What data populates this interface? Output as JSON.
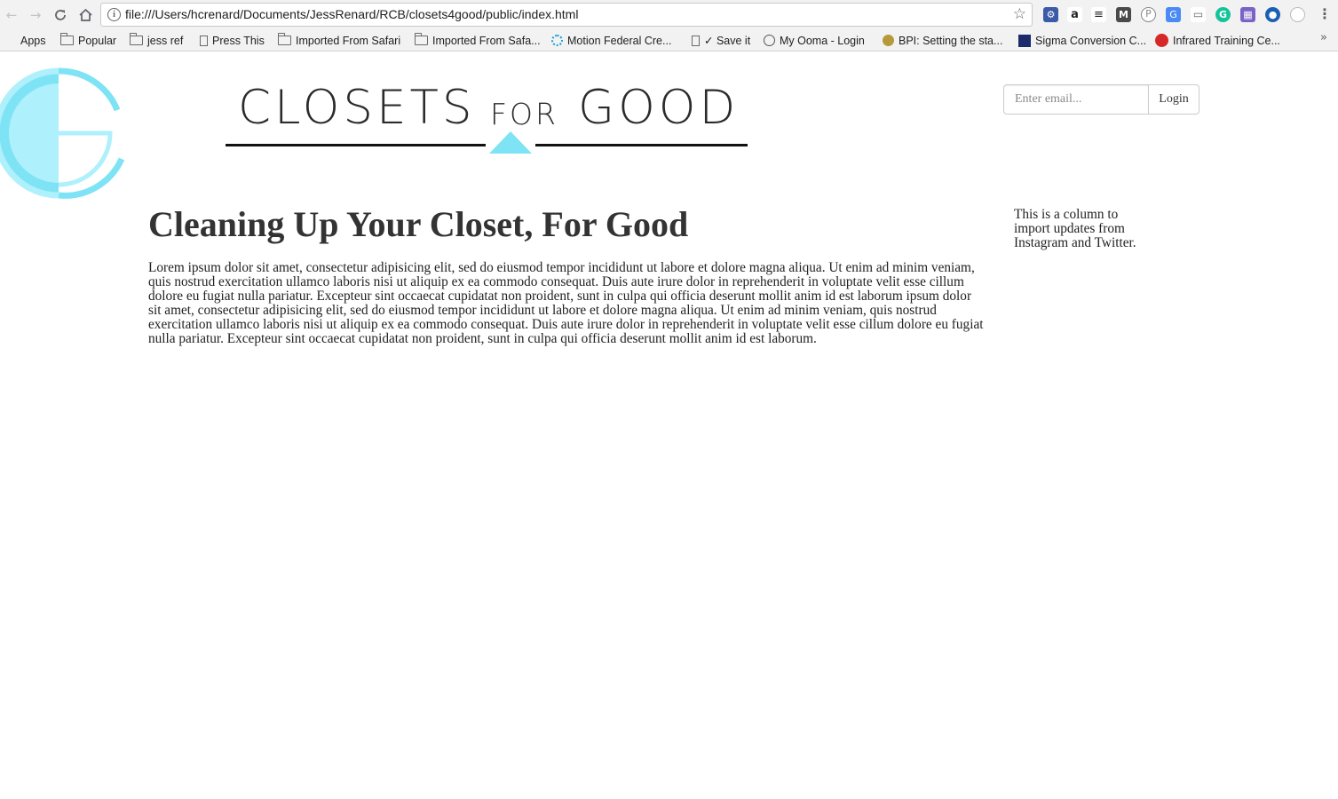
{
  "browser": {
    "url": "file:///Users/hcrenard/Documents/JessRenard/RCB/closets4good/public/index.html",
    "icons": {
      "back": "back-arrow-icon",
      "forward": "forward-arrow-icon",
      "reload": "reload-icon",
      "home": "home-icon",
      "info": "info-icon",
      "bookmark_star": "star-icon",
      "menu": "more-vert-icon",
      "overflow": "chevron-right-double-icon"
    },
    "bookmarks": [
      {
        "label": "Apps",
        "icon": "apps-grid-icon"
      },
      {
        "label": "Popular",
        "icon": "folder-icon"
      },
      {
        "label": "jess ref",
        "icon": "folder-icon"
      },
      {
        "label": "Press This",
        "icon": "page-icon"
      },
      {
        "label": "Imported From Safari",
        "icon": "folder-icon"
      },
      {
        "label": "Imported From Safa...",
        "icon": "folder-icon"
      },
      {
        "label": "Motion Federal Cre...",
        "icon": "motion-logo-icon"
      },
      {
        "label": "✓ Save it",
        "icon": "page-icon"
      },
      {
        "label": "My Ooma - Login",
        "icon": "ooma-logo-icon"
      },
      {
        "label": "BPI: Setting the sta...",
        "icon": "bpi-logo-icon"
      },
      {
        "label": "Sigma Conversion C...",
        "icon": "sigma-logo-icon"
      },
      {
        "label": "Infrared Training Ce...",
        "icon": "itc-logo-icon"
      }
    ],
    "extensions": [
      "tools-extension-icon",
      "amazon-extension-icon",
      "buffer-extension-icon",
      "medium-extension-icon",
      "pinterest-extension-icon",
      "translate-extension-icon",
      "cast-extension-icon",
      "grammarly-extension-icon",
      "calendar-extension-icon",
      "onenote-extension-icon",
      "loading-extension-icon"
    ]
  },
  "header": {
    "logo_icon": "cg-circle-logo-icon",
    "brand_words": [
      "CLOSETS",
      "FOR",
      "GOOD"
    ],
    "colors": {
      "accent": "#7ee3f4",
      "accent_light": "#aef0fb",
      "text": "#2b2b2b"
    }
  },
  "login": {
    "email_placeholder": "Enter email...",
    "button_label": "Login"
  },
  "main": {
    "headline": "Cleaning Up Your Closet, For Good",
    "body": "Lorem ipsum dolor sit amet, consectetur adipisicing elit, sed do eiusmod tempor incididunt ut labore et dolore magna aliqua. Ut enim ad minim veniam, quis nostrud exercitation ullamco laboris nisi ut aliquip ex ea commodo consequat. Duis aute irure dolor in reprehenderit in voluptate velit esse cillum dolore eu fugiat nulla pariatur. Excepteur sint occaecat cupidatat non proident, sunt in culpa qui officia deserunt mollit anim id est laborum ipsum dolor sit amet, consectetur adipisicing elit, sed do eiusmod tempor incididunt ut labore et dolore magna aliqua. Ut enim ad minim veniam, quis nostrud exercitation ullamco laboris nisi ut aliquip ex ea commodo consequat. Duis aute irure dolor in reprehenderit in voluptate velit esse cillum dolore eu fugiat nulla pariatur. Excepteur sint occaecat cupidatat non proident, sunt in culpa qui officia deserunt mollit anim id est laborum."
  },
  "sidebar": {
    "note": "This is a column to import updates from Instagram and Twitter."
  }
}
